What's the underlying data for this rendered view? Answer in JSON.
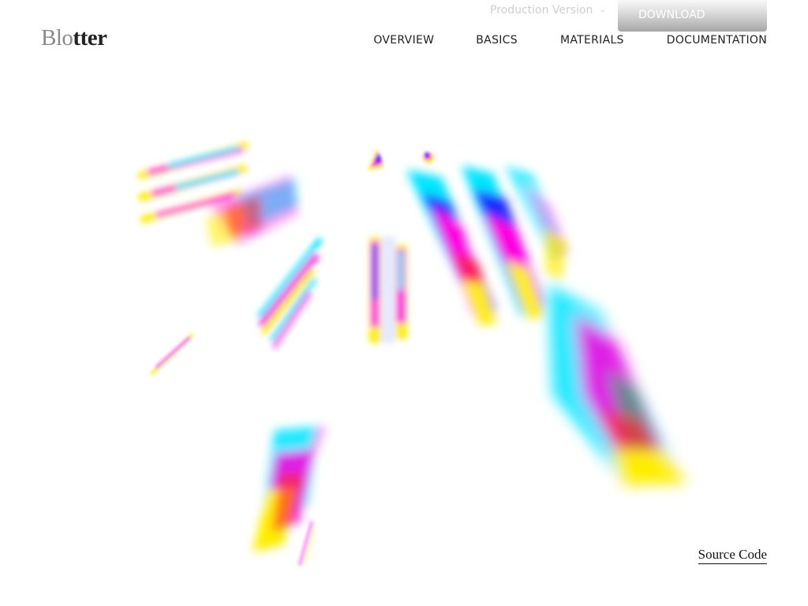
{
  "header": {
    "logo_part1": "Blo",
    "logo_part2": "tter",
    "version_label": "Production Version",
    "download_label": "DOWNLOAD"
  },
  "nav": {
    "items": [
      {
        "label": "OVERVIEW"
      },
      {
        "label": "BASICS"
      },
      {
        "label": "MATERIALS"
      },
      {
        "label": "DOCUMENTATION"
      }
    ]
  },
  "footer": {
    "source_code_label": "Source Code"
  },
  "colors": {
    "cyan": "#00e5ff",
    "magenta": "#ff00e0",
    "yellow": "#ffee00",
    "blue": "#1a2cff",
    "red": "#ff2a2a"
  }
}
